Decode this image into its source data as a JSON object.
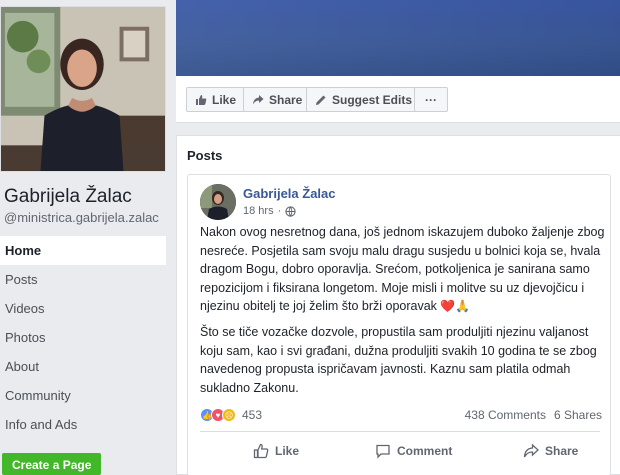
{
  "profile": {
    "name": "Gabrijela Žalac",
    "handle": "@ministrica.gabrijela.zalac"
  },
  "nav": [
    {
      "label": "Home",
      "active": true
    },
    {
      "label": "Posts"
    },
    {
      "label": "Videos"
    },
    {
      "label": "Photos"
    },
    {
      "label": "About"
    },
    {
      "label": "Community"
    },
    {
      "label": "Info and Ads"
    }
  ],
  "create_page_label": "Create a Page",
  "actions": {
    "like": "Like",
    "share": "Share",
    "suggest": "Suggest Edits",
    "more": "···"
  },
  "posts_header": "Posts",
  "post": {
    "author": "Gabrijela Žalac",
    "time": "18 hrs",
    "time_sep": "·",
    "paragraph1": "Nakon ovog nesretnog dana, još jednom iskazujem duboko žaljenje zbog nesreće. Posjetila sam svoju malu dragu susjedu u bolnici koja se, hvala dragom Bogu, dobro oporavlja. Srećom, potkoljenica je sanirana samo repozicijom i fiksirana longetom. Moje misli i molitve su uz djevojčicu i njezinu obitelj te joj želim što brži oporavak",
    "paragraph1_emoji": "❤️🙏",
    "paragraph2": "Što se tiče vozačke dozvole, propustila sam produljiti njezinu valjanost koju sam, kao i svi građani, dužna produljiti svakih 10 godina te se zbog navedenog propusta ispričavam javnosti. Kaznu sam platila odmah sukladno Zakonu.",
    "reaction_count": "453",
    "comments": "438 Comments",
    "shares": "6 Shares",
    "like_label": "Like",
    "comment_label": "Comment",
    "share_label": "Share"
  },
  "colors": {
    "brand_blue": "#3b5998",
    "link_blue": "#385898",
    "green": "#42b72a"
  }
}
